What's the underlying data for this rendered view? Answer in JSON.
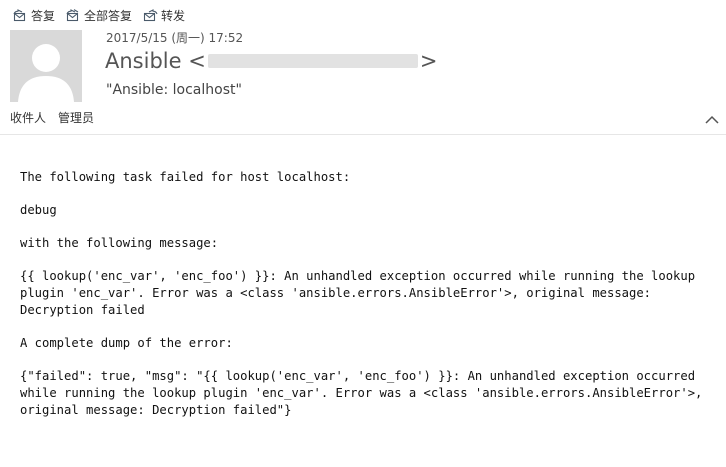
{
  "toolbar": {
    "reply": "答复",
    "reply_all": "全部答复",
    "forward": "转发"
  },
  "email": {
    "date": "2017/5/15 (周一) 17:52",
    "sender_name": "Ansible <",
    "sender_close": ">",
    "subject": "\"Ansible: localhost\""
  },
  "recipients": {
    "to_label": "收件人",
    "admin_label": "管理员"
  },
  "body": {
    "line1": "The following task failed for host localhost:",
    "line2": "debug",
    "line3": "with the following message:",
    "line4": "{{ lookup('enc_var', 'enc_foo') }}: An unhandled exception occurred while running the lookup plugin 'enc_var'. Error was a <class 'ansible.errors.AnsibleError'>, original message: Decryption failed",
    "line5": "A complete dump of the error:",
    "line6": "{\"failed\": true, \"msg\": \"{{ lookup('enc_var', 'enc_foo') }}: An unhandled exception occurred while running the lookup plugin 'enc_var'. Error was a <class 'ansible.errors.AnsibleError'>, original message: Decryption failed\"}"
  },
  "icons": {
    "reply": "reply-icon",
    "reply_all": "reply-all-icon",
    "forward": "forward-icon",
    "avatar": "default-avatar",
    "collapse": "chevron-up-icon"
  },
  "colors": {
    "avatar_bg": "#d9d9d9",
    "icon_stroke": "#4a5a6a",
    "divider": "#e6e6e6"
  }
}
